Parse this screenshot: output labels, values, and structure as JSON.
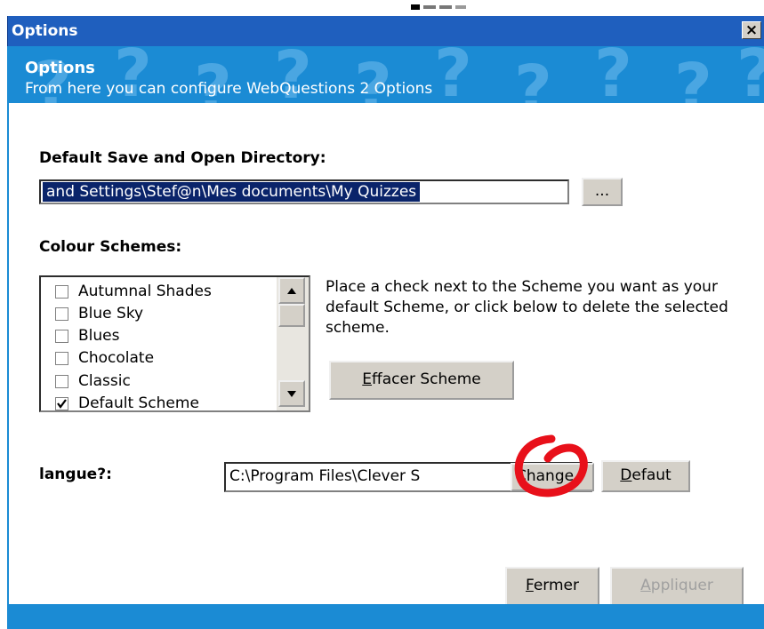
{
  "window": {
    "title": "Options",
    "close_glyph": "×"
  },
  "header": {
    "title": "Options",
    "subtitle": "From here you can configure WebQuestions 2 Options",
    "bg_color": "#1b8bd4"
  },
  "directory": {
    "label": "Default Save and Open Directory:",
    "value": "and Settings\\Stef@n\\Mes documents\\My Quizzes",
    "browse_label": "..."
  },
  "schemes": {
    "label": "Colour Schemes:",
    "items": [
      {
        "label": "Autumnal Shades",
        "checked": false
      },
      {
        "label": "Blue Sky",
        "checked": false
      },
      {
        "label": "Blues",
        "checked": false
      },
      {
        "label": "Chocolate",
        "checked": false
      },
      {
        "label": "Classic",
        "checked": false
      },
      {
        "label": "Default Scheme",
        "checked": true
      }
    ],
    "info": "Place a check next to the Scheme you want as your default Scheme, or click below to delete the selected scheme.",
    "delete_label_first": "E",
    "delete_label_rest": "ffacer Scheme"
  },
  "language": {
    "label": "langue?:",
    "value": "C:\\Program Files\\Clever S",
    "change_label": "Change",
    "default_label_first": "D",
    "default_label_rest": "efaut"
  },
  "actions": {
    "close_first": "F",
    "close_rest": "ermer",
    "apply_first": "A",
    "apply_rest": "ppliquer"
  },
  "annotation_color": "#e8101a"
}
